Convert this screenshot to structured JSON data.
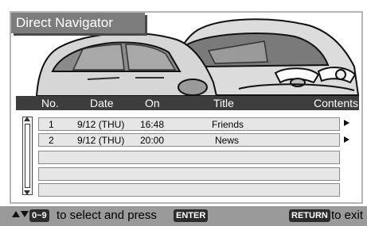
{
  "app": {
    "title": "Direct Navigator"
  },
  "table": {
    "headers": {
      "no": "No.",
      "date": "Date",
      "on": "On",
      "title": "Title",
      "contents": "Contents"
    },
    "rows": [
      {
        "no": "1",
        "date": "9/12 (THU)",
        "on": "16:48",
        "title": "Friends"
      },
      {
        "no": "2",
        "date": "9/12 (THU)",
        "on": "20:00",
        "title": "News"
      },
      {
        "no": "",
        "date": "",
        "on": "",
        "title": ""
      },
      {
        "no": "",
        "date": "",
        "on": "",
        "title": ""
      },
      {
        "no": "",
        "date": "",
        "on": "",
        "title": ""
      }
    ]
  },
  "footer": {
    "key_range": "0~9",
    "select_text": "to select and press",
    "enter_key": "ENTER",
    "return_key": "RETURN",
    "exit_text": "to exit"
  },
  "icons": {
    "nav_arrows": "up-down-arrows-icon",
    "row_pointer": "right-triangle-icon",
    "background": "car-illustration"
  },
  "colors": {
    "header_bg": "#3d3d3d",
    "title_bg": "#7d7d7d",
    "row_bg": "#e6e6e6",
    "footer_bg": "#9a9a9a",
    "key_bg": "#2b2b2b"
  }
}
